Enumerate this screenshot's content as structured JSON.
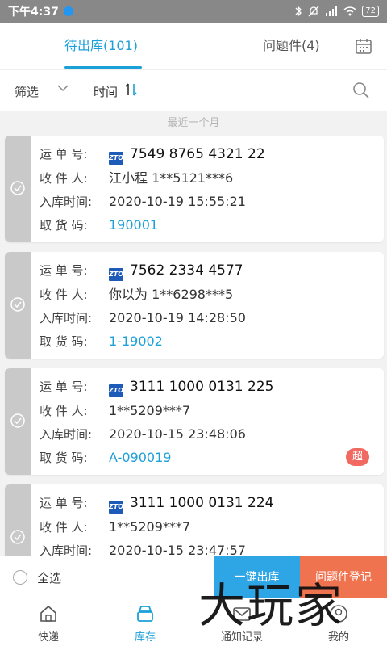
{
  "status_bar": {
    "time": "下午4:37",
    "battery": "72"
  },
  "tabs": [
    {
      "label": "待出库(101)",
      "active": true
    },
    {
      "label": "问题件(4)",
      "active": false
    }
  ],
  "filter": {
    "filter_label": "筛选",
    "time_label": "时间"
  },
  "section_label": "最近一个月",
  "labels": {
    "waybill": "运 单 号:",
    "receiver": "收 件 人:",
    "time_in": "入库时间:",
    "pickup_code": "取 货 码:"
  },
  "carrier_icon_text": "ZTO",
  "parcels": [
    {
      "waybill": "7549 8765 4321 22",
      "receiver": "江小程 1**5121***6",
      "time_in": "2020-10-19 15:55:21",
      "pickup_code": "190001"
    },
    {
      "waybill": "7562 2334 4577",
      "receiver": "你以为 1**6298***5",
      "time_in": "2020-10-19 14:28:50",
      "pickup_code": "1-19002"
    },
    {
      "waybill": "3111 1000 0131 225",
      "receiver": "1**5209***7",
      "time_in": "2020-10-15 23:48:06",
      "pickup_code": "A-090019",
      "badge": "超"
    },
    {
      "waybill": "3111 1000 0131 224",
      "receiver": "1**5209***7",
      "time_in": "2020-10-15 23:47:57",
      "pickup_code": ""
    }
  ],
  "actions": {
    "select_all": "全选",
    "checkout": "一键出库",
    "problem_register": "问题件登记"
  },
  "nav": [
    {
      "label": "快递",
      "icon": "home-icon"
    },
    {
      "label": "库存",
      "icon": "inventory-icon",
      "active": true
    },
    {
      "label": "通知记录",
      "icon": "mail-icon"
    },
    {
      "label": "我的",
      "icon": "profile-icon"
    }
  ],
  "watermark": "大玩家",
  "colors": {
    "accent": "#1ba0d8",
    "checkout": "#2ea6e6",
    "problem": "#f0734f",
    "badge": "#f06a62"
  }
}
